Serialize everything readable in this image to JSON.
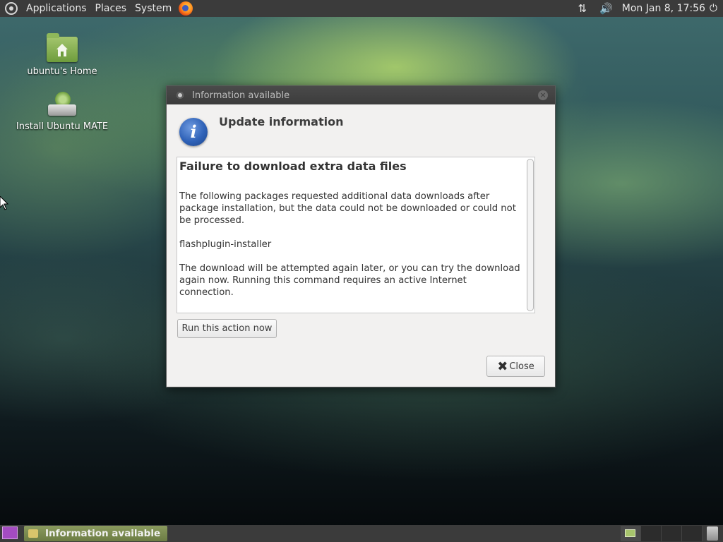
{
  "top_panel": {
    "menu_applications": "Applications",
    "menu_places": "Places",
    "menu_system": "System",
    "clock": "Mon Jan 8, 17:56",
    "network_icon": "⇅",
    "volume_icon": "🔊",
    "power_icon": "⏻"
  },
  "desktop": {
    "icons": [
      {
        "label": "ubuntu's Home"
      },
      {
        "label": "Install Ubuntu MATE"
      }
    ]
  },
  "dialog": {
    "window_title": "Information available",
    "close_glyph": "×",
    "info_glyph": "i",
    "heading": "Update information",
    "content": {
      "title": "Failure to download extra data files",
      "paragraphs": [
        "The following packages requested additional data downloads after package installation, but the data could not be downloaded or could not be processed.",
        "flashplugin-installer",
        "The download will be attempted again later, or you can try the download again now.  Running this command requires an active Internet connection."
      ]
    },
    "run_button": "Run this action now",
    "close_button": "Close",
    "close_button_glyph": "✖"
  },
  "bottom_panel": {
    "task_label": "Information available"
  }
}
